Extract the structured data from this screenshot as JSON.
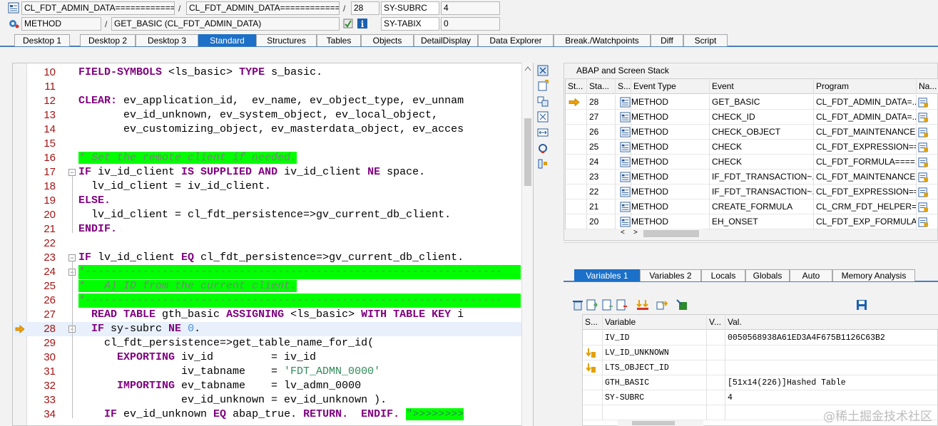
{
  "header": {
    "row1": {
      "program": "CL_FDT_ADMIN_DATA============...",
      "include": "CL_FDT_ADMIN_DATA============...",
      "line": "28",
      "sysvar_name": "SY-SUBRC",
      "sysvar_value": "4",
      "sep": "/"
    },
    "row2": {
      "event_type": "METHOD",
      "event": "GET_BASIC (CL_FDT_ADMIN_DATA)",
      "sysvar_name": "SY-TABIX",
      "sysvar_value": "0",
      "sep": "/"
    }
  },
  "tabs": [
    "Desktop 1",
    "Desktop 2",
    "Desktop 3",
    "Standard",
    "Structures",
    "Tables",
    "Objects",
    "DetailDisplay",
    "Data Explorer",
    "Break./Watchpoints",
    "Diff",
    "Script"
  ],
  "active_tab": "Standard",
  "editor": {
    "lines": [
      {
        "n": "10"
      },
      {
        "n": "11"
      },
      {
        "n": "12"
      },
      {
        "n": "13"
      },
      {
        "n": "14"
      },
      {
        "n": "15"
      },
      {
        "n": "16"
      },
      {
        "n": "17"
      },
      {
        "n": "18"
      },
      {
        "n": "19"
      },
      {
        "n": "20"
      },
      {
        "n": "21"
      },
      {
        "n": "22"
      },
      {
        "n": "23"
      },
      {
        "n": "24"
      },
      {
        "n": "25"
      },
      {
        "n": "26"
      },
      {
        "n": "27"
      },
      {
        "n": "28"
      },
      {
        "n": "29"
      },
      {
        "n": "30"
      },
      {
        "n": "31"
      },
      {
        "n": "32"
      },
      {
        "n": "33"
      },
      {
        "n": "34"
      }
    ],
    "code": {
      "l10": [
        "FIELD-SYMBOLS",
        " <ls_basic> ",
        "TYPE",
        " s_basic."
      ],
      "l12": [
        "CLEAR:",
        " ev_application_id,  ev_name, ev_object_type, ev_unnam"
      ],
      "l13": "       ev_id_unknown, ev_system_object, ev_local_object,",
      "l14": "       ev_customizing_object, ev_masterdata_object, ev_acces",
      "l16": "* Set the remote client if needed.",
      "l17": [
        "IF",
        " iv_id_client ",
        "IS SUPPLIED AND",
        " iv_id_client ",
        "NE",
        " space."
      ],
      "l18": "  lv_id_client = iv_id_client.",
      "l19": "ELSE.",
      "l20": "  lv_id_client = cl_fdt_persistence=>gv_current_db_client.",
      "l21": "ENDIF.",
      "l23": [
        "IF",
        " lv_id_client ",
        "EQ",
        " cl_fdt_persistence=>gv_current_db_client."
      ],
      "l24": "*-----------------------------------------------------------------",
      "l25": "*   A) ID from the current client.",
      "l26": "*-----------------------------------------------------------------",
      "l27": [
        "  READ TABLE",
        " gth_basic ",
        "ASSIGNING",
        " <ls_basic> ",
        "WITH TABLE KEY",
        " i"
      ],
      "l28": [
        "  IF",
        " sy-subrc ",
        "NE",
        " ",
        "0",
        "."
      ],
      "l29": "    cl_fdt_persistence=>get_table_name_for_id(",
      "l30": [
        "      EXPORTING",
        " iv_id         = iv_id"
      ],
      "l31": [
        "                iv_tabname    = ",
        "'FDT_ADMN_0000'"
      ],
      "l32": [
        "      IMPORTING",
        " ev_tabname    = lv_admn_0000"
      ],
      "l33": "                ev_id_unknown = ev_id_unknown ).",
      "l34": [
        "    IF",
        " ev_id_unknown ",
        "EQ",
        " abap_true. ",
        "RETURN.",
        "  ",
        "ENDIF.",
        " ",
        "\">>>>>>>>"
      ]
    }
  },
  "stack": {
    "title": "ABAP and Screen Stack",
    "columns": [
      "St...",
      "Sta...",
      "S...",
      "Event Type",
      "Event",
      "Program",
      "Na..."
    ],
    "rows": [
      {
        "level": "28",
        "type": "METHOD",
        "event": "GET_BASIC",
        "program": "CL_FDT_ADMIN_DATA=...",
        "current": true
      },
      {
        "level": "27",
        "type": "METHOD",
        "event": "CHECK_ID",
        "program": "CL_FDT_ADMIN_DATA=...",
        "current": false
      },
      {
        "level": "26",
        "type": "METHOD",
        "event": "CHECK_OBJECT",
        "program": "CL_FDT_MAINTENANCE...",
        "current": false
      },
      {
        "level": "25",
        "type": "METHOD",
        "event": "CHECK",
        "program": "CL_FDT_EXPRESSION==...",
        "current": false
      },
      {
        "level": "24",
        "type": "METHOD",
        "event": "CHECK",
        "program": "CL_FDT_FORMULA====...",
        "current": false
      },
      {
        "level": "23",
        "type": "METHOD",
        "event": "IF_FDT_TRANSACTION~...",
        "program": "CL_FDT_MAINTENANCE...",
        "current": false
      },
      {
        "level": "22",
        "type": "METHOD",
        "event": "IF_FDT_TRANSACTION~...",
        "program": "CL_FDT_EXPRESSION==...",
        "current": false
      },
      {
        "level": "21",
        "type": "METHOD",
        "event": "CREATE_FORMULA",
        "program": "CL_CRM_FDT_HELPER=...",
        "current": false
      },
      {
        "level": "20",
        "type": "METHOD",
        "event": "EH_ONSET",
        "program": "CL_FDT_EXP_FORMULAV...",
        "current": false
      }
    ]
  },
  "var_tabs": [
    "Variables 1",
    "Variables 2",
    "Locals",
    "Globals",
    "Auto",
    "Memory Analysis"
  ],
  "active_var_tab": "Variables 1",
  "variables": {
    "columns": [
      "S...",
      "Variable",
      "V...",
      "Val."
    ],
    "rows": [
      {
        "name": "IV_ID",
        "value": "0050568938A61ED3A4F675B1126C63B2",
        "changed": false
      },
      {
        "name": "LV_ID_UNKNOWN",
        "value": "",
        "changed": true
      },
      {
        "name": "LTS_OBJECT_ID",
        "value": "",
        "changed": true
      },
      {
        "name": "GTH_BASIC",
        "value": "[51x14(226)]Hashed Table",
        "changed": false
      },
      {
        "name": "SY-SUBRC",
        "value": "4",
        "changed": false
      },
      {
        "name": "",
        "value": "",
        "changed": false
      }
    ]
  },
  "watermark": "@稀土掘金技术社区",
  "colors": {
    "accent": "#1c70c8",
    "keyword": "#800080",
    "comment_bg": "#00ff00",
    "line_number": "#a31515"
  }
}
